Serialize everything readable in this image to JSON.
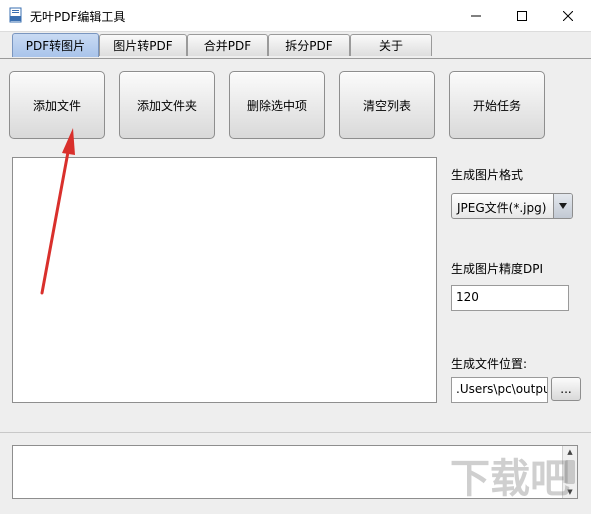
{
  "window": {
    "title": "无叶PDF编辑工具",
    "icon": "pdf-app-icon"
  },
  "tabs": [
    {
      "label": "PDF转图片",
      "active": true
    },
    {
      "label": "图片转PDF",
      "active": false
    },
    {
      "label": "合并PDF",
      "active": false
    },
    {
      "label": "拆分PDF",
      "active": false
    },
    {
      "label": "关于",
      "active": false
    }
  ],
  "toolbar": {
    "add_file": "添加文件",
    "add_folder": "添加文件夹",
    "delete_selected": "删除选中项",
    "clear_list": "清空列表",
    "start_task": "开始任务"
  },
  "settings": {
    "format_label": "生成图片格式",
    "format_value": "JPEG文件(*.jpg)",
    "dpi_label": "生成图片精度DPI",
    "dpi_value": "120",
    "location_label": "生成文件位置:",
    "location_value": ".Users\\pc\\output",
    "browse_label": "..."
  },
  "annotation": {
    "type": "red-arrow",
    "color": "#d9302c"
  },
  "watermark": {
    "text": "下载吧"
  }
}
